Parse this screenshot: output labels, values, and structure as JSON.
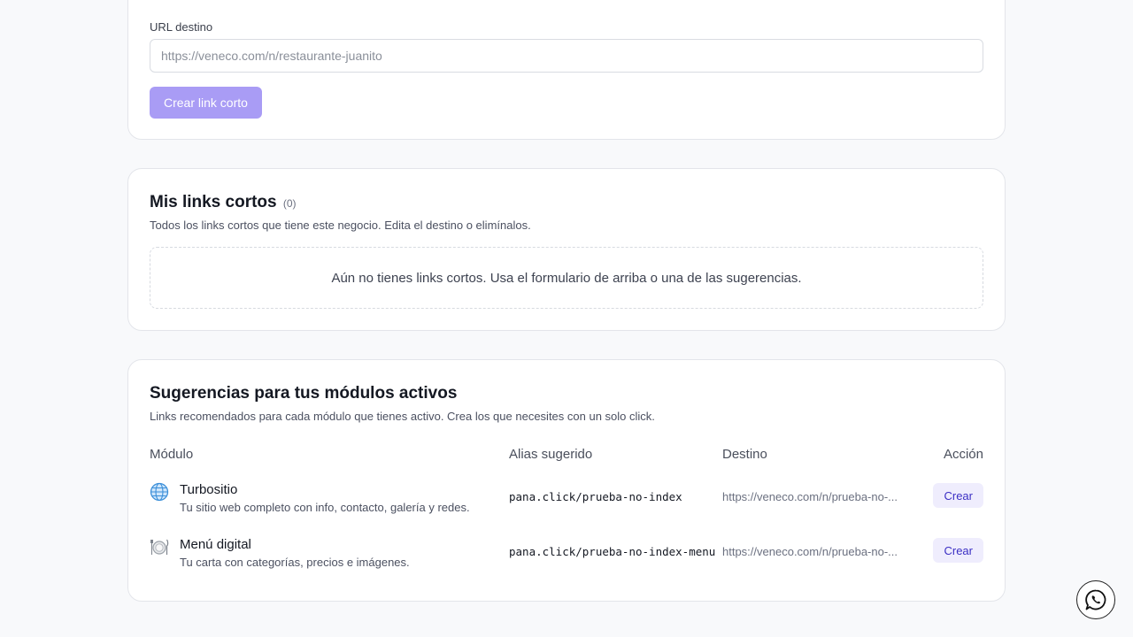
{
  "form": {
    "url_label": "URL destino",
    "url_placeholder": "https://veneco.com/n/restaurante-juanito",
    "url_value": "",
    "create_label": "Crear link corto"
  },
  "links": {
    "title": "Mis links cortos",
    "count": "(0)",
    "subtitle": "Todos los links cortos que tiene este negocio. Edita el destino o elimínalos.",
    "empty_message": "Aún no tienes links cortos. Usa el formulario de arriba o una de las sugerencias."
  },
  "suggestions": {
    "title": "Sugerencias para tus módulos activos",
    "subtitle": "Links recomendados para cada módulo que tienes activo. Crea los que necesites con un solo click.",
    "columns": [
      "Módulo",
      "Alias sugerido",
      "Destino",
      "Acción"
    ],
    "rows": [
      {
        "icon": "globe-icon",
        "name": "Turbositio",
        "description": "Tu sitio web completo con info, contacto, galería y redes.",
        "alias": "pana.click/prueba-no-index",
        "destination": "https://veneco.com/n/prueba-no-...",
        "action": "Crear"
      },
      {
        "icon": "plate-icon",
        "name": "Menú digital",
        "description": "Tu carta con categorías, precios e imágenes.",
        "alias": "pana.click/prueba-no-index-menu",
        "destination": "https://veneco.com/n/prueba-no-...",
        "action": "Crear"
      }
    ]
  },
  "colors": {
    "accent_disabled": "#a99cf5",
    "accent_text": "#3b2fc4",
    "accent_soft": "#efedfd"
  },
  "fab": {
    "icon": "whatsapp-icon"
  }
}
